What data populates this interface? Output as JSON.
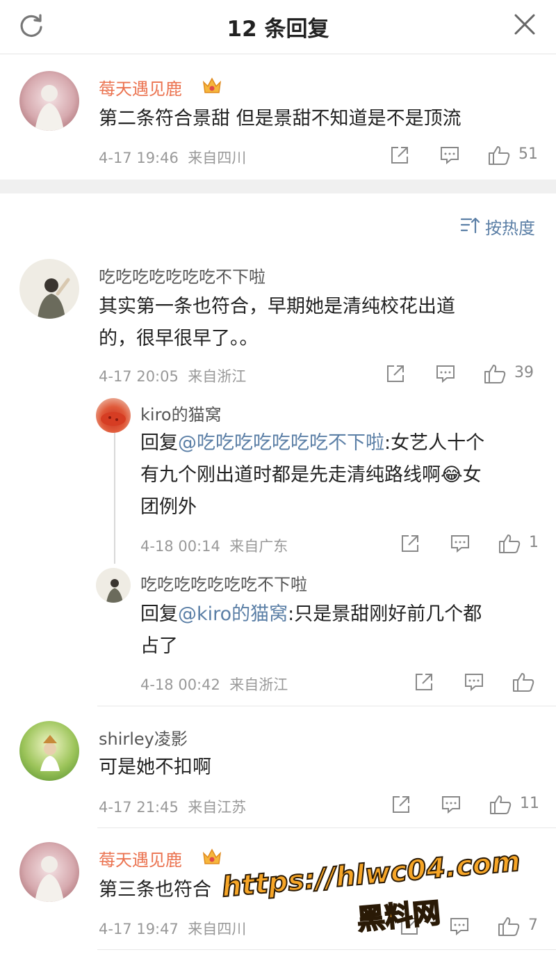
{
  "header": {
    "title": "12 条回复"
  },
  "sort": {
    "label": "按热度"
  },
  "comments": [
    {
      "name": "莓天遇见鹿",
      "text": "第二条符合景甜 但是景甜不知道是不是顶流",
      "time": "4-17 19:46",
      "location": "来自四川",
      "likes": "51"
    },
    {
      "name": "吃吃吃吃吃吃吃不下啦",
      "text_line1": "其实第一条也符合，早期她是清纯校花出道",
      "text_line2": "的，很早很早了。。",
      "time": "4-17 20:05",
      "location": "来自浙江",
      "likes": "39",
      "replies": [
        {
          "name": "kiro的猫窝",
          "reply_prefix": "回复",
          "mention": "@吃吃吃吃吃吃吃不下啦",
          "text_line1": ":女艺人十个",
          "text_line2": "有九个刚出道时都是先走清纯路线啊",
          "emoji": "😂",
          "text_line2b": "女",
          "text_line3": "团例外",
          "time": "4-18 00:14",
          "location": "来自广东",
          "likes": "1"
        },
        {
          "name": "吃吃吃吃吃吃吃不下啦",
          "reply_prefix": "回复",
          "mention": "@kiro的猫窝",
          "text_line1": ":只是景甜刚好前几个都",
          "text_line2": "占了",
          "time": "4-18 00:42",
          "location": "来自浙江",
          "likes": ""
        }
      ]
    },
    {
      "name": "shirley凌影",
      "text": "可是她不扣啊",
      "time": "4-17 21:45",
      "location": "来自江苏",
      "likes": "11"
    },
    {
      "name": "莓天遇见鹿",
      "text": "第三条也符合",
      "time": "4-17 19:47",
      "location": "来自四川",
      "likes": "7"
    }
  ],
  "watermark": {
    "url": "https://hlwc04.com",
    "label": "黑料网"
  },
  "colors": {
    "accent": "#eb7350",
    "link": "#5b7fa6",
    "meta": "#999999",
    "divider": "#f0f0f0"
  }
}
